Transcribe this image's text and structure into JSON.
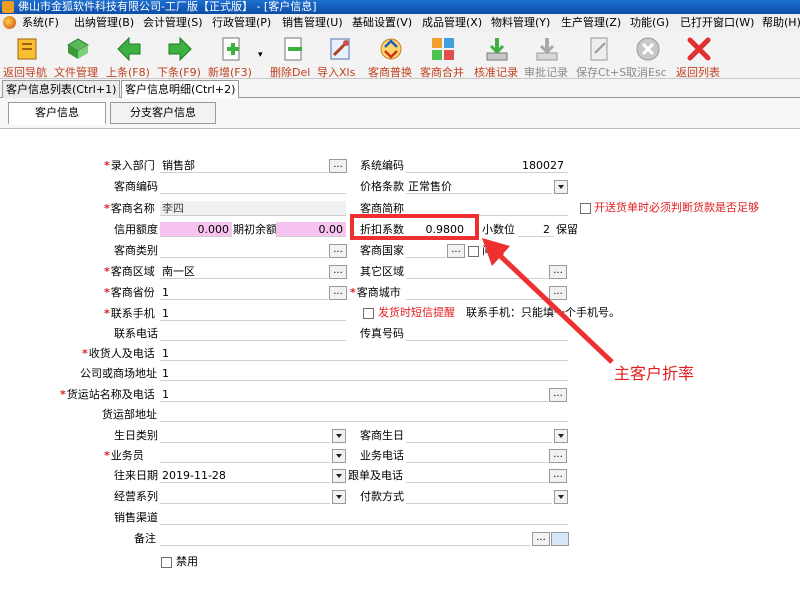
{
  "window": {
    "title": "佛山市金狐软件科技有限公司-工厂版【正式版】 - [客户信息]"
  },
  "menu": {
    "items": [
      "系统(F)",
      "出纳管理(B)",
      "会计管理(S)",
      "行政管理(P)",
      "销售管理(U)",
      "基础设置(V)",
      "成品管理(X)",
      "物料管理(Y)",
      "生产管理(Z)",
      "功能(G)",
      "已打开窗口(W)",
      "帮助(H)"
    ]
  },
  "toolbar": {
    "items": [
      {
        "label": "返回导航",
        "icon": "nav-back-icon"
      },
      {
        "label": "文件管理",
        "icon": "file-manage-icon"
      },
      {
        "label": "上条(F8)",
        "icon": "arrow-left-icon"
      },
      {
        "label": "下条(F9)",
        "icon": "arrow-right-icon"
      },
      {
        "label": "新增(F3)",
        "icon": "new-doc-icon"
      },
      {
        "label": "删除Del",
        "icon": "delete-doc-icon"
      },
      {
        "label": "导入Xls",
        "icon": "import-xls-icon"
      },
      {
        "label": "客商普换",
        "icon": "swap-icon"
      },
      {
        "label": "客商合并",
        "icon": "merge-icon"
      },
      {
        "label": "核准记录",
        "icon": "approve-icon"
      },
      {
        "label": "审批记录",
        "icon": "review-icon"
      },
      {
        "label": "保存Ct+S",
        "icon": "save-icon"
      },
      {
        "label": "取消Esc",
        "icon": "cancel-icon"
      },
      {
        "label": "返回列表",
        "icon": "close-list-icon"
      }
    ]
  },
  "tabs": [
    "客户信息列表(Ctrl+1)",
    "客户信息明细(Ctrl+2)"
  ],
  "subtabs": [
    "客户信息",
    "分支客户信息"
  ],
  "form": {
    "dept_label": "录入部门",
    "dept_value": "销售部",
    "syscode_label": "系统编码",
    "syscode_value": "180027",
    "code_label": "客商编码",
    "code_value": "",
    "price_label": "价格条款",
    "price_value": "正常售价",
    "name_label": "客商名称",
    "name_value": "李四",
    "short_label": "客商简称",
    "short_value": "",
    "credit_label": "信用额度",
    "credit_value": "0.000",
    "opening_label": "期初余额",
    "opening_value": "0.00",
    "discount_label": "折扣系数",
    "discount_value": "0.9800",
    "decimal_label": "小数位",
    "decimal_value": "2",
    "keep_label": "保留",
    "type_label": "客商类别",
    "type_value": "",
    "country_label": "客商国家",
    "country_value": "",
    "question_label": "问题",
    "region_label": "客商区域",
    "region_value": "南一区",
    "other_region_label": "其它区域",
    "other_region_value": "",
    "province_label": "客商省份",
    "province_value": "1",
    "city_label": "客商城市",
    "city_value": "",
    "mobile_label": "联系手机",
    "mobile_value": "1",
    "sms_label": "发货时短信提醒",
    "mobile_hint": "联系手机：只能填一个手机号。",
    "phone_label": "联系电话",
    "phone_value": "",
    "fax_label": "传真号码",
    "fax_value": "",
    "receiver_label": "收货人及电话",
    "receiver_value": "1",
    "address_label": "公司或商场地址",
    "address_value": "1",
    "station_label": "货运站名称及电话",
    "station_value": "1",
    "dept_addr_label": "货运部地址",
    "dept_addr_value": "",
    "birthday_type_label": "生日类别",
    "birthday_type_value": "",
    "birthday_label": "客商生日",
    "birthday_value": "",
    "salesman_label": "业务员",
    "salesman_value": "",
    "bizphone_label": "业务电话",
    "bizphone_value": "",
    "date_label": "往来日期",
    "date_value": "2019-11-28",
    "follow_label": "跟单及电话",
    "follow_value": "",
    "series_label": "经营系列",
    "series_value": "",
    "pay_label": "付款方式",
    "pay_value": "",
    "channel_label": "销售渠道",
    "channel_value": "",
    "note_label": "备注",
    "note_value": "",
    "disable_label": "禁用",
    "check_label": "开送货单时必须判断货款是否足够"
  },
  "annotation": {
    "text": "主客户折率",
    "color": "#e02020"
  }
}
